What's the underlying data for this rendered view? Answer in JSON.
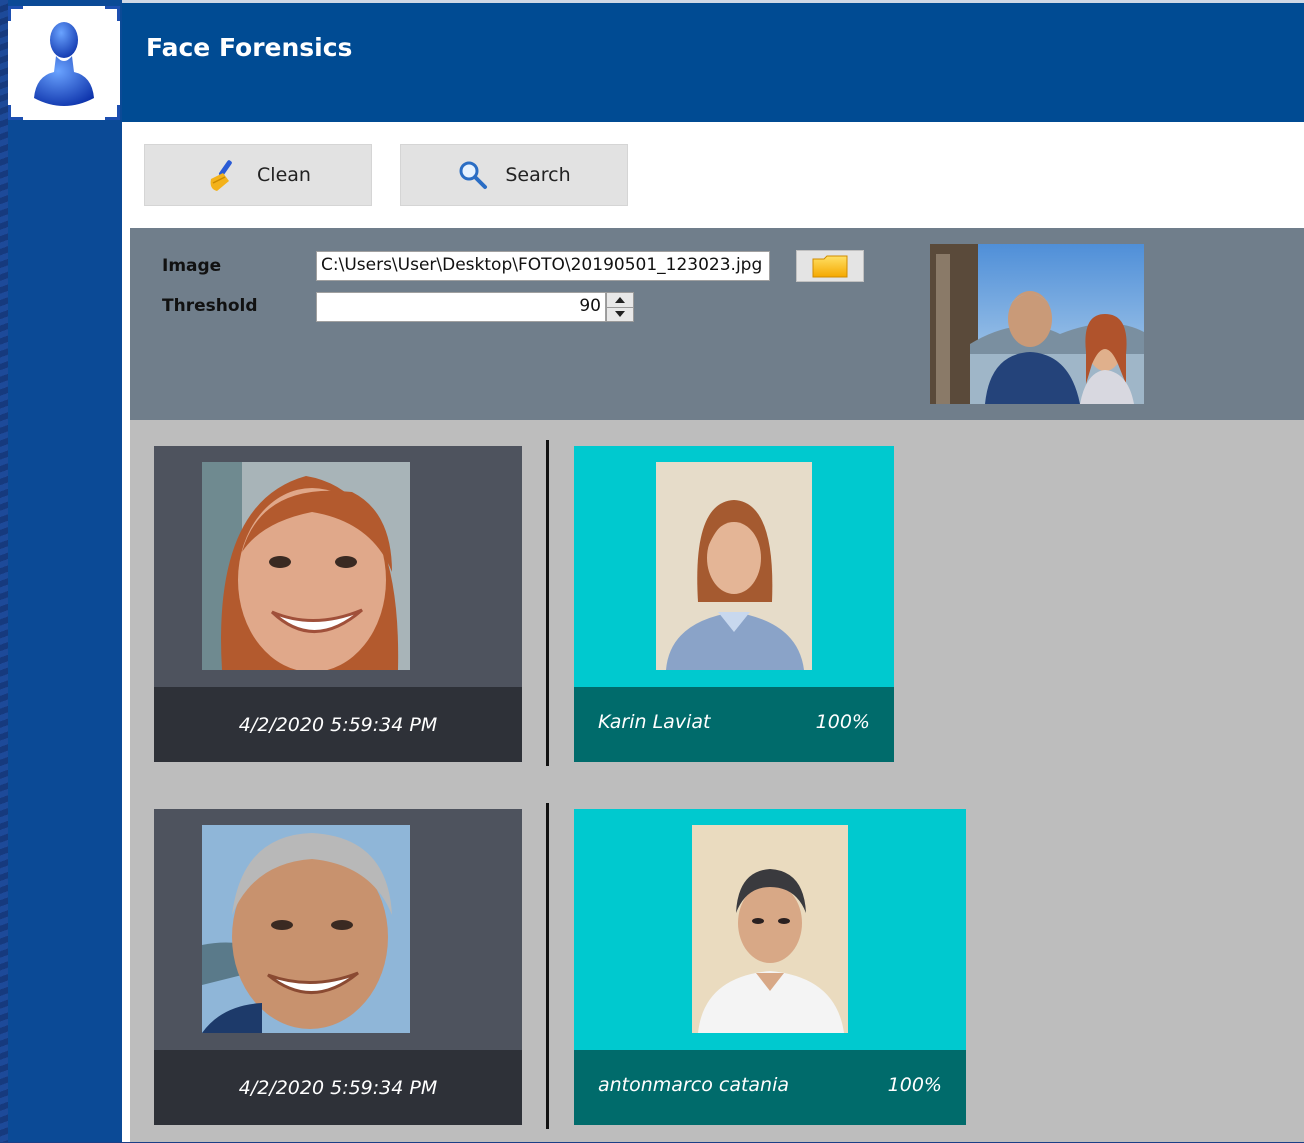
{
  "app": {
    "title": "Face Forensics",
    "logo_icon": "person-bust-icon"
  },
  "toolbar": {
    "clean_label": "Clean",
    "clean_icon": "broom-icon",
    "search_label": "Search",
    "search_icon": "magnifier-icon"
  },
  "form": {
    "image_label": "Image",
    "image_path": "C:\\Users\\User\\Desktop\\FOTO\\20190501_123023.jpg",
    "browse_icon": "folder-icon",
    "threshold_label": "Threshold",
    "threshold_value": "90"
  },
  "results": [
    {
      "query_timestamp": "4/2/2020 5:59:34 PM",
      "match_name": "Karin Laviat",
      "match_score": "100%"
    },
    {
      "query_timestamp": "4/2/2020 5:59:34 PM",
      "match_name": "antonmarco catania",
      "match_score": "100%"
    }
  ],
  "colors": {
    "header": "#004b93",
    "rail": "#0b4a96",
    "panel": "#707e8b",
    "results_bg": "#bdbdbd",
    "query_card": "#4e535e",
    "query_footer": "#2e3138",
    "match_card": "#00c9cf",
    "match_footer": "#006b6b"
  }
}
